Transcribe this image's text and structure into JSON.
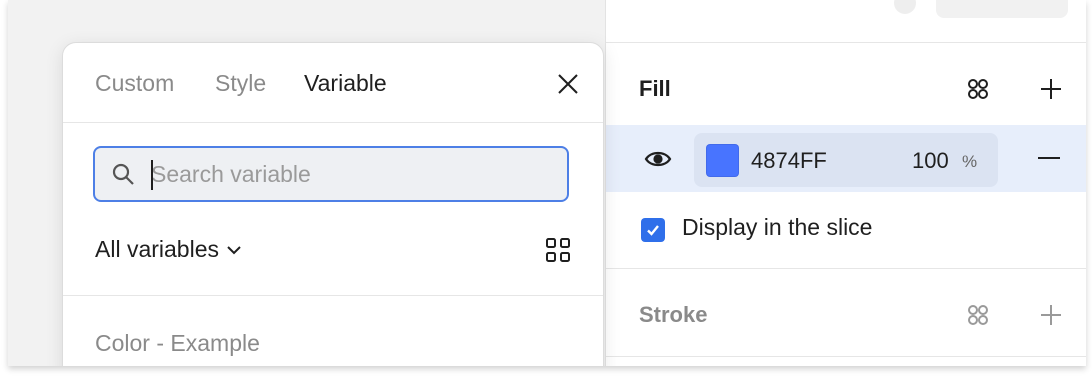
{
  "inspector": {
    "fill": {
      "title": "Fill",
      "color": {
        "hex": "4874FF",
        "swatch": "#4874FF",
        "opacity": "100",
        "unit": "%"
      },
      "display_label": "Display in the slice",
      "display_checked": true
    },
    "stroke": {
      "title": "Stroke"
    }
  },
  "picker": {
    "tabs": [
      {
        "label": "Custom",
        "active": false
      },
      {
        "label": "Style",
        "active": false
      },
      {
        "label": "Variable",
        "active": true
      }
    ],
    "search": {
      "placeholder": "Search variable",
      "value": ""
    },
    "filter_label": "All variables",
    "group_label": "Color - Example"
  },
  "icons": {
    "close": "close-icon",
    "search": "search-icon",
    "chevron": "chevron-down-icon",
    "grid": "grid-view-icon",
    "styles": "styles-icon",
    "add": "plus-icon",
    "remove": "minus-icon",
    "visibility": "eye-icon",
    "check": "checkmark-icon"
  },
  "colors": {
    "accent": "#2f6fea",
    "selection_bg": "#e7eefb"
  }
}
